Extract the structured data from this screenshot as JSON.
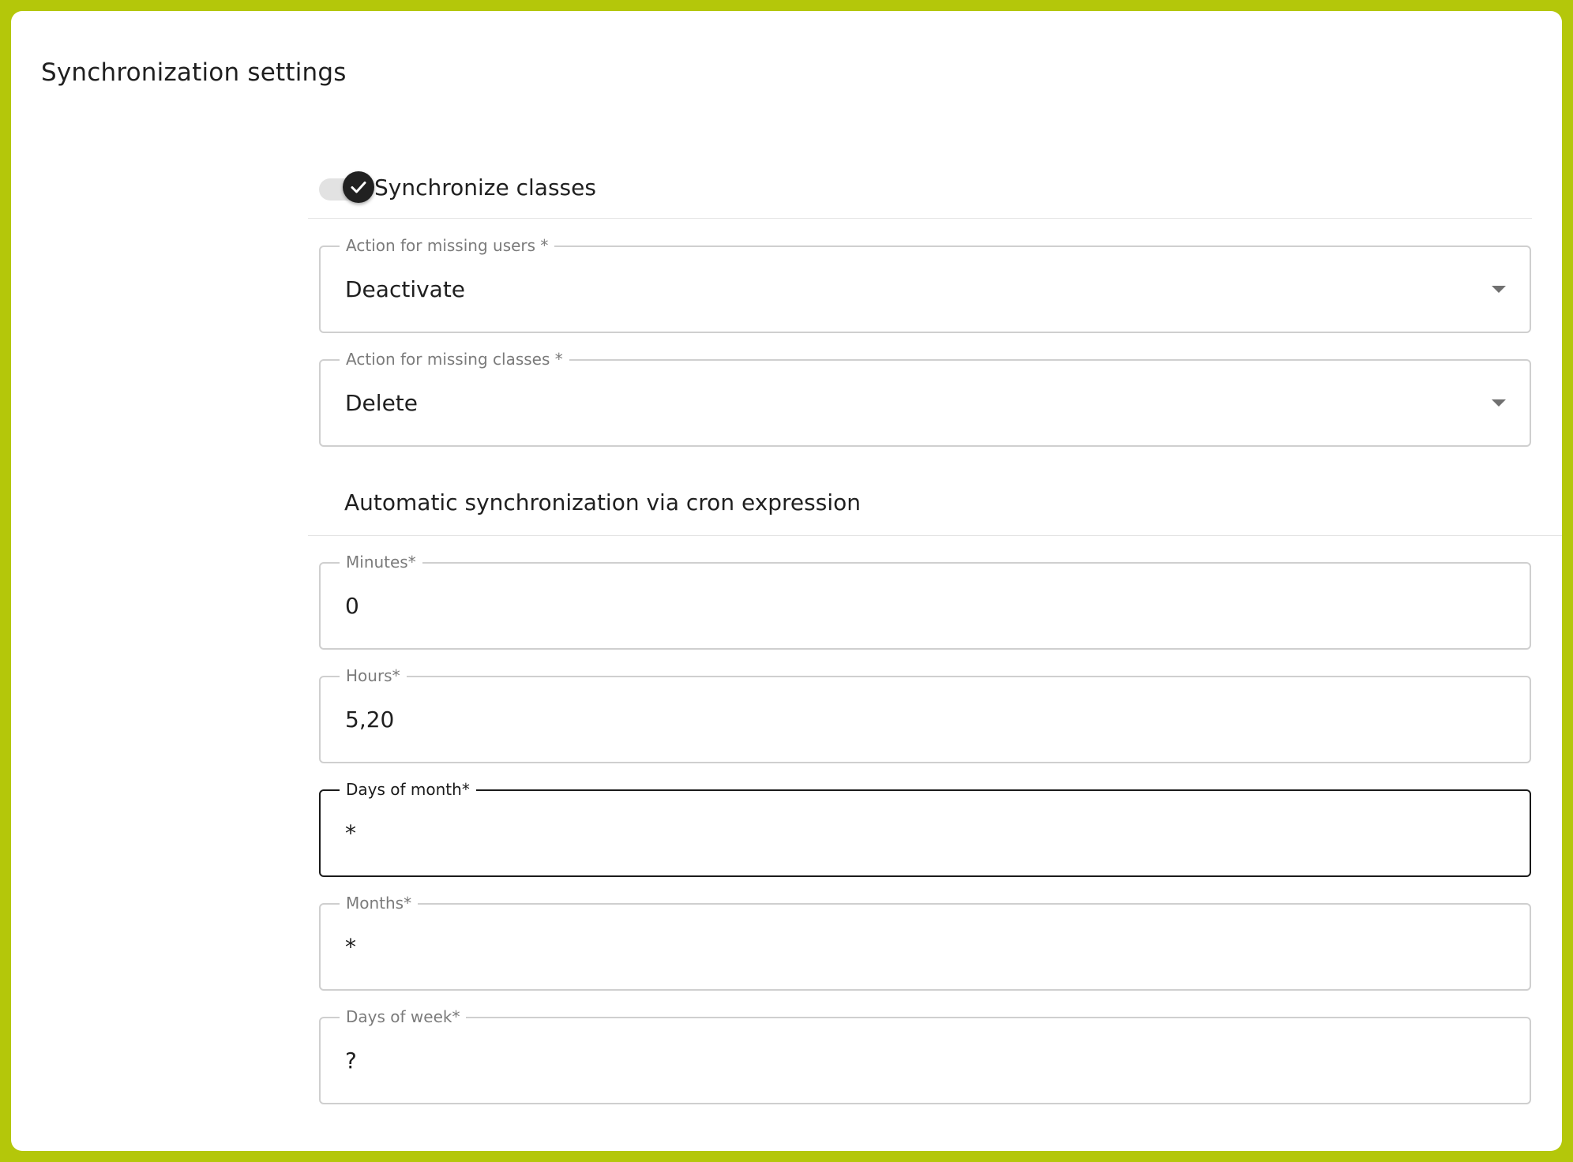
{
  "page": {
    "title": "Synchronization settings",
    "frame_color": "#b4c70a"
  },
  "toggle": {
    "label": "Synchronize classes",
    "checked": true,
    "thumb_color": "#212121"
  },
  "selects": {
    "missing_users": {
      "label": "Action for missing users *",
      "value": "Deactivate"
    },
    "missing_classes": {
      "label": "Action for missing classes *",
      "value": "Delete"
    }
  },
  "cron": {
    "heading": "Automatic synchronization via cron expression",
    "minutes": {
      "label": "Minutes*",
      "value": "0"
    },
    "hours": {
      "label": "Hours*",
      "value": "5,20"
    },
    "days_of_month": {
      "label": "Days of month*",
      "value": "*",
      "focused": true
    },
    "months": {
      "label": "Months*",
      "value": "*"
    },
    "days_of_week": {
      "label": "Days of week*",
      "value": "?"
    }
  }
}
